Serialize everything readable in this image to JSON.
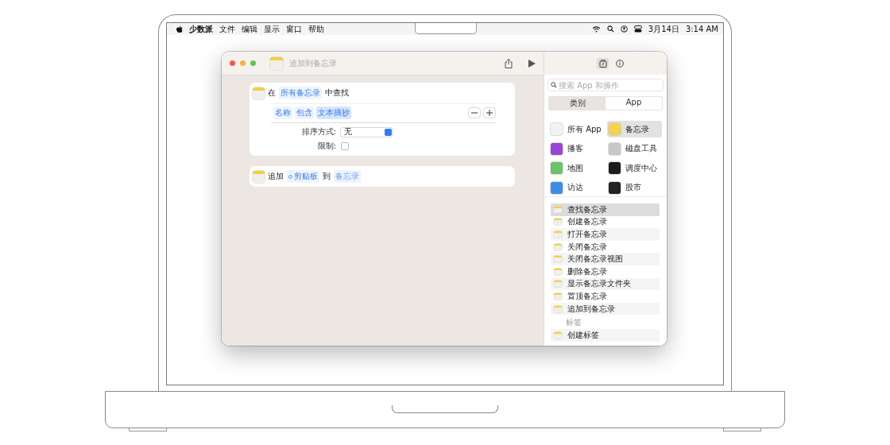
{
  "menu_bar": {
    "items": [
      "少数派",
      "文件",
      "编辑",
      "显示",
      "窗口",
      "帮助"
    ],
    "date": "3月14日",
    "time": "3:14 AM"
  },
  "window": {
    "title": "追加到备忘录"
  },
  "actions": [
    {
      "kind": "find",
      "prefix": "在",
      "token": "所有备忘录",
      "suffix": "中查找",
      "filters": [
        "名称",
        "包含",
        "文本摘抄"
      ],
      "sort_label": "排序方式:",
      "sort_value": "无",
      "limit_label": "限制:",
      "limit_checked": false
    },
    {
      "kind": "append",
      "prefix": "追加",
      "token": "剪贴板",
      "middle": "到",
      "target": "备忘录"
    }
  ],
  "sidebar": {
    "search": {
      "placeholder": "搜索 App 和操作"
    },
    "tabs": [
      {
        "label": "类别",
        "selected": false
      },
      {
        "label": "App",
        "selected": true
      }
    ],
    "apps": [
      {
        "label": "所有 App",
        "selected": false,
        "color": "#f2f2f2"
      },
      {
        "label": "备忘录",
        "selected": true,
        "color": "#f7d24a"
      },
      {
        "label": "播客",
        "selected": false,
        "color": "#9b44d8"
      },
      {
        "label": "磁盘工具",
        "selected": false,
        "color": "#c8c8c8"
      },
      {
        "label": "地图",
        "selected": false,
        "color": "#6cc36a"
      },
      {
        "label": "调度中心",
        "selected": false,
        "color": "#1c1c1c"
      },
      {
        "label": "访达",
        "selected": false,
        "color": "#3a8ee8"
      },
      {
        "label": "股市",
        "selected": false,
        "color": "#222222"
      }
    ],
    "action_items": [
      {
        "label": "查找备忘录",
        "selected": true
      },
      {
        "label": "创建备忘录",
        "selected": false
      },
      {
        "label": "打开备忘录",
        "selected": false
      },
      {
        "label": "关闭备忘录",
        "selected": false
      },
      {
        "label": "关闭备忘录视图",
        "selected": false
      },
      {
        "label": "删除备忘录",
        "selected": false
      },
      {
        "label": "显示备忘录文件夹",
        "selected": false
      },
      {
        "label": "置顶备忘录",
        "selected": false
      },
      {
        "label": "追加到备忘录",
        "selected": false
      }
    ],
    "section": {
      "label": "标签",
      "items": [
        "创建标签"
      ]
    }
  }
}
